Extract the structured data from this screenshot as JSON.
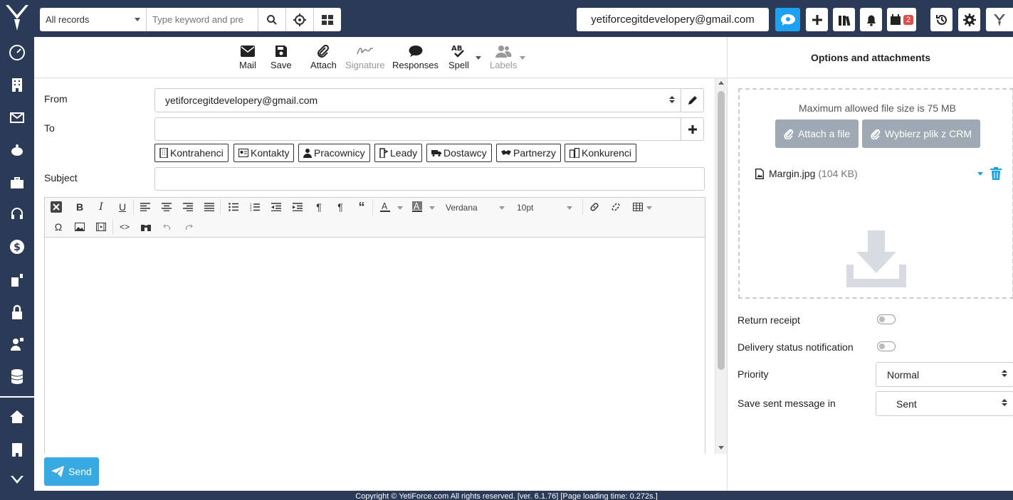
{
  "topbar": {
    "search_scope": "All records",
    "search_placeholder": "Type keyword and pre",
    "user_email": "yetiforcegitdevelopery@gmail.com",
    "notification_badge": "2"
  },
  "compose_toolbar": {
    "mail": "Mail",
    "save": "Save",
    "attach": "Attach",
    "signature": "Signature",
    "responses": "Responses",
    "spell": "Spell",
    "labels": "Labels"
  },
  "form": {
    "from_label": "From",
    "from_value": "yetiforcegitdevelopery@gmail.com",
    "to_label": "To",
    "subject_label": "Subject",
    "related_modules": [
      "Kontrahenci",
      "Kontakty",
      "Pracownicy",
      "Leady",
      "Dostawcy",
      "Partnerzy",
      "Konkurenci"
    ],
    "font_family": "Verdana",
    "font_size": "10pt"
  },
  "send_label": "Send",
  "right_panel": {
    "title": "Options and attachments",
    "max_file_size": "Maximum allowed file size is 75 MB",
    "attach_file": "Attach a file",
    "choose_crm": "Wybierz plik z CRM",
    "file_name": "Margin.jpg",
    "file_size": "(104 KB)",
    "return_receipt": "Return receipt",
    "delivery_status": "Delivery status notification",
    "priority_label": "Priority",
    "priority_value": "Normal",
    "save_sent_label": "Save sent message in",
    "save_sent_value": "Sent"
  },
  "footer": {
    "copyright": "Copyright © YetiForce.com All rights reserved. [ver. 6.1.76] [Page loading time: 0.272s.]"
  },
  "colors": {
    "sidebar": "#2b3a57",
    "accent": "#1da1f2",
    "send": "#39aae1",
    "attach_button": "#9ea9b3",
    "trash": "#1a9fe0"
  }
}
